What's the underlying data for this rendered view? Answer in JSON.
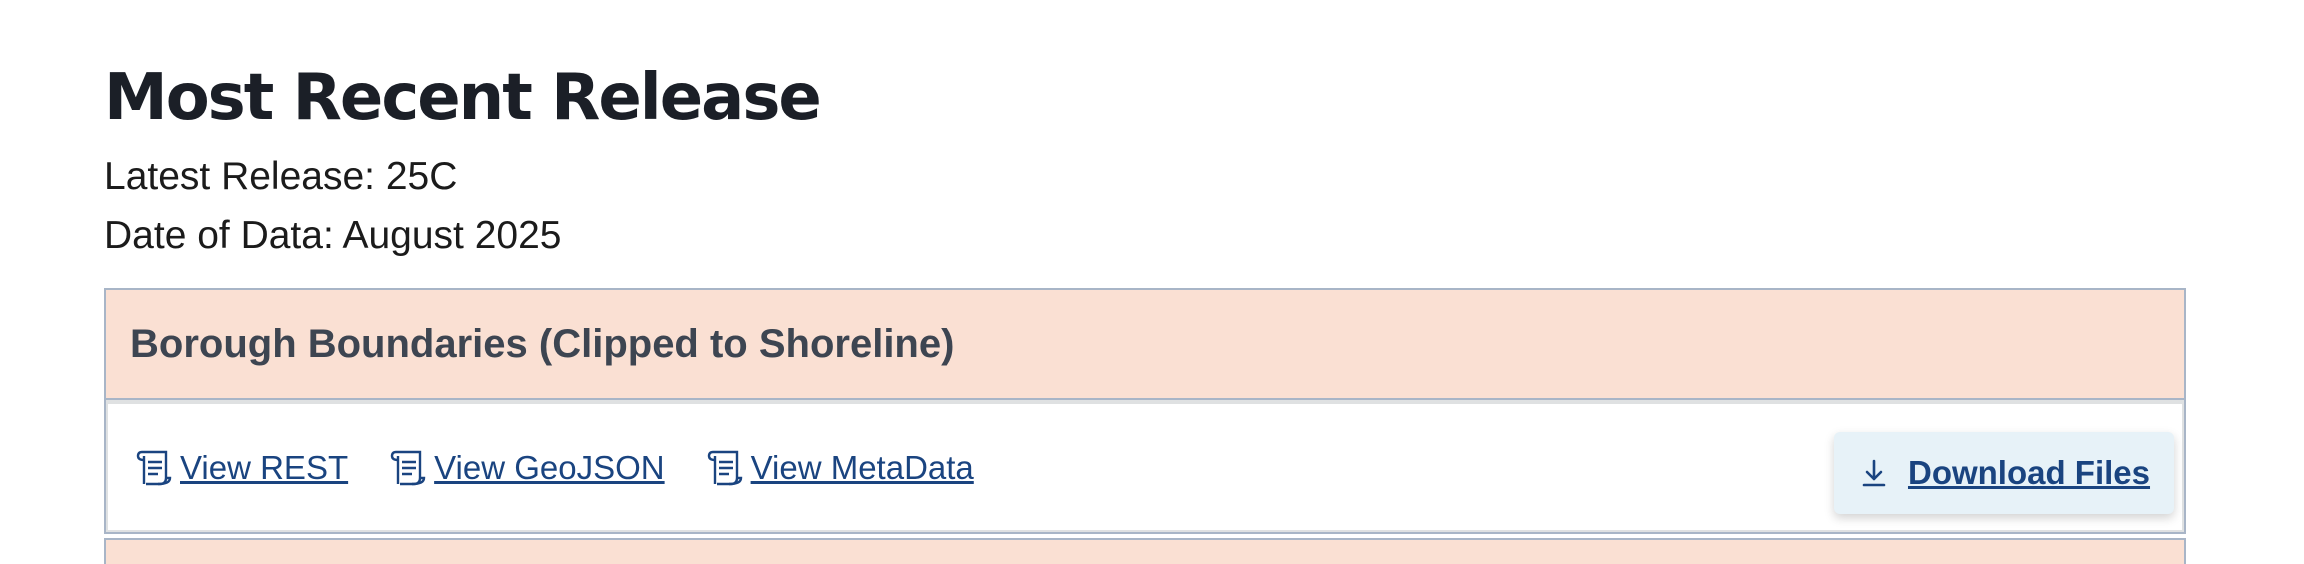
{
  "page": {
    "title": "Most Recent Release",
    "latest_release": "Latest Release: 25C",
    "date_of_data": "Date of Data: August 2025"
  },
  "dataset": {
    "title": "Borough Boundaries (Clipped to Shoreline)",
    "links": [
      {
        "label": "View REST",
        "icon": "scroll-doc-icon"
      },
      {
        "label": "View GeoJSON",
        "icon": "scroll-doc-icon"
      },
      {
        "label": "View MetaData",
        "icon": "scroll-doc-icon"
      }
    ],
    "download": {
      "label": "Download Files",
      "icon": "download-icon"
    }
  },
  "colors": {
    "header_bg": "#fae0d3",
    "border": "#a8b5c7",
    "link": "#1a4480",
    "button_bg": "#e7f2f8"
  }
}
